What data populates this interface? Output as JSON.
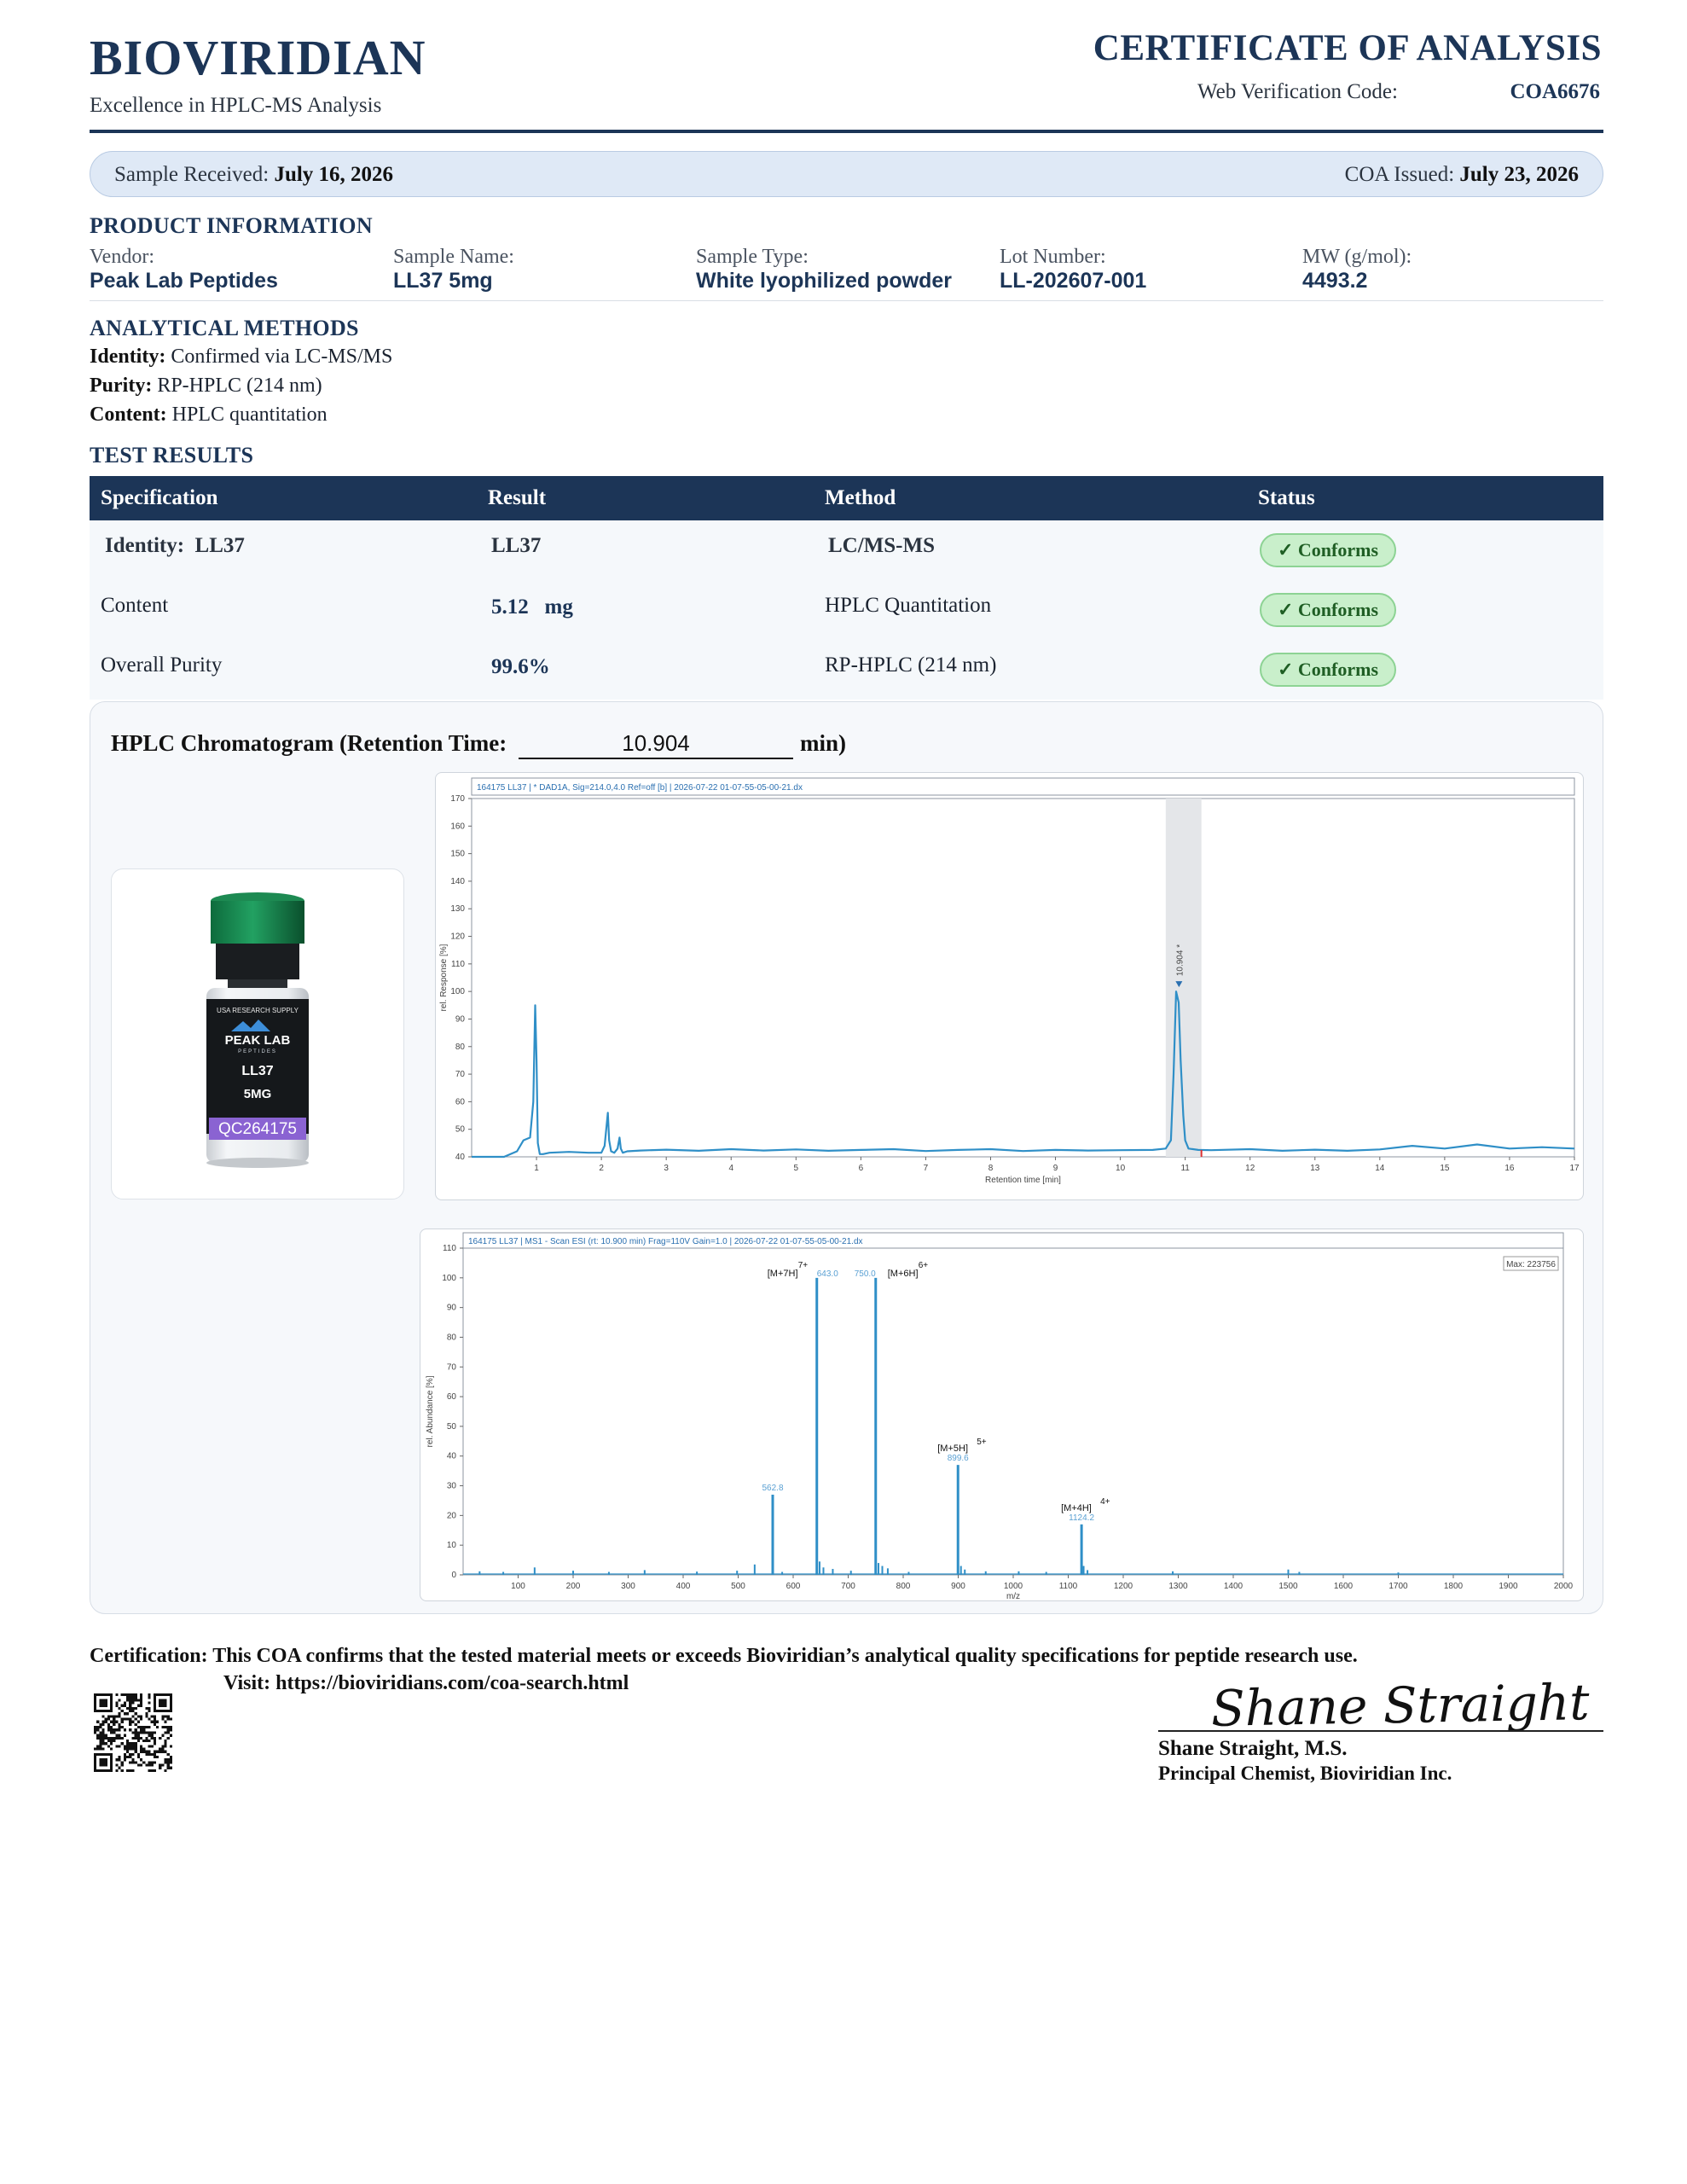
{
  "header": {
    "brand": "BIOVIRIDIAN",
    "tagline": "Excellence in HPLC-MS Analysis",
    "document_title": "CERTIFICATE OF ANALYSIS",
    "verification_label": "Web Verification Code:",
    "verification_code": "COA6676"
  },
  "dates": {
    "received_label": "Sample Received:",
    "received_value": "July 16, 2026",
    "issued_label": "COA Issued:",
    "issued_value": "July 23, 2026"
  },
  "product": {
    "heading": "PRODUCT INFORMATION",
    "fields": [
      {
        "label": "Vendor:",
        "value": "Peak Lab Peptides"
      },
      {
        "label": "Sample Name:",
        "value": "LL37 5mg"
      },
      {
        "label": "Sample Type:",
        "value": "White lyophilized powder"
      },
      {
        "label": "Lot Number:",
        "value": "LL-202607-001"
      },
      {
        "label": "MW (g/mol):",
        "value": "4493.2"
      }
    ]
  },
  "methods": {
    "heading": "ANALYTICAL METHODS",
    "lines": [
      {
        "label": "Identity:",
        "value": "Confirmed via LC-MS/MS"
      },
      {
        "label": "Purity:",
        "value": "RP-HPLC (214 nm)"
      },
      {
        "label": "Content:",
        "value": "HPLC quantitation"
      }
    ]
  },
  "results": {
    "heading": "TEST RESULTS",
    "columns": [
      "Specification",
      "Result",
      "Method",
      "Status"
    ],
    "rows": [
      {
        "spec": "Identity:  LL37",
        "result": "LL37",
        "method": "LC/MS-MS",
        "status": "✓ Conforms"
      },
      {
        "spec": "Content",
        "result": "5.12   mg",
        "method": "HPLC Quantitation",
        "status": "✓ Conforms"
      },
      {
        "spec": "Overall Purity",
        "result": "99.6%",
        "method": "RP-HPLC (214 nm)",
        "status": "✓ Conforms"
      }
    ]
  },
  "chromatogram": {
    "title": "HPLC Chromatogram (Retention Time:",
    "retention_time": "10.904",
    "unit": "min)",
    "vial": {
      "supplier": "USA RESEARCH SUPPLY",
      "brand": "PEAK LAB",
      "brand_sub": "PEPTIDES",
      "product": "LL37",
      "dose": "5MG",
      "qc_code": "QC264175"
    }
  },
  "chart_data": [
    {
      "type": "line",
      "header": "164175 LL37 | * DAD1A, Sig=214.0,4.0 Ref=off [b] | 2026-07-22 01-07-55-05-00-21.dx",
      "xlabel": "Retention time [min]",
      "ylabel": "rel. Response [%]",
      "xlim": [
        0,
        17
      ],
      "ylim": [
        40,
        170
      ],
      "x_ticks": [
        1,
        2,
        3,
        4,
        5,
        6,
        7,
        8,
        9,
        10,
        11,
        12,
        13,
        14,
        15,
        16,
        17
      ],
      "y_ticks": [
        40,
        50,
        60,
        70,
        80,
        90,
        100,
        110,
        120,
        130,
        140,
        150,
        160,
        170
      ],
      "peak_label": "10.904 *",
      "series": [
        {
          "x": [
            0.0,
            0.5,
            0.7,
            0.8,
            0.9,
            0.95,
            0.98,
            1.0,
            1.02,
            1.05,
            1.1,
            1.2,
            1.5,
            1.8,
            2.0,
            2.05,
            2.1,
            2.12,
            2.15,
            2.2,
            2.25,
            2.28,
            2.3,
            2.33,
            2.4,
            2.6,
            3.0,
            3.5,
            4.0,
            4.5,
            5.0,
            5.5,
            6.0,
            6.5,
            7.0,
            7.5,
            8.0,
            8.5,
            9.0,
            9.5,
            10.0,
            10.5,
            10.7,
            10.78,
            10.82,
            10.86,
            10.9,
            10.93,
            10.97,
            11.0,
            11.05,
            11.2,
            11.4,
            12.0,
            12.5,
            13.0,
            13.5,
            14.0,
            14.5,
            15.0,
            15.5,
            16.0,
            16.5,
            17.0
          ],
          "y": [
            40,
            40,
            42,
            46,
            47,
            60,
            95,
            75,
            45,
            41,
            41,
            41.5,
            41.8,
            41.5,
            41.5,
            44,
            56,
            46,
            42,
            41.5,
            43,
            47,
            43,
            41.5,
            42,
            42.3,
            42.6,
            42.2,
            42.8,
            42.3,
            42.7,
            42.2,
            42.5,
            42.8,
            42.1,
            42.5,
            42.8,
            42.1,
            42.5,
            42.3,
            42.4,
            42.5,
            43,
            46,
            70,
            100,
            96,
            75,
            55,
            46,
            43,
            42.5,
            42.4,
            42.8,
            42.2,
            42.6,
            42.2,
            42.7,
            44,
            43,
            44.5,
            43,
            43.5,
            43
          ]
        }
      ]
    },
    {
      "type": "bar",
      "header": "164175 LL37 | MS1 - Scan ESI (rt: 10.900 min) Frag=110V Gain=1.0 | 2026-07-22 01-07-55-05-00-21.dx",
      "xlabel": "m/z",
      "ylabel": "rel. Abundance [%]",
      "xlim": [
        0,
        2000
      ],
      "ylim": [
        0,
        110
      ],
      "x_ticks": [
        100,
        200,
        300,
        400,
        500,
        600,
        700,
        800,
        900,
        1000,
        1100,
        1200,
        1300,
        1400,
        1500,
        1600,
        1700,
        1800,
        1900,
        2000
      ],
      "y_ticks": [
        0,
        10,
        20,
        30,
        40,
        50,
        60,
        70,
        80,
        90,
        100,
        110
      ],
      "max_label": "Max: 223756",
      "peaks": [
        {
          "mz": 562.8,
          "intensity": 27,
          "label": "562.8"
        },
        {
          "mz": 643.0,
          "intensity": 100,
          "label": "643.0",
          "ion": "[M+7H]",
          "charge": "7+"
        },
        {
          "mz": 750.0,
          "intensity": 100,
          "label": "750.0",
          "ion": "[M+6H]",
          "charge": "6+"
        },
        {
          "mz": 899.6,
          "intensity": 37,
          "label": "899.6",
          "ion": "[M+5H]",
          "charge": "5+"
        },
        {
          "mz": 1124.2,
          "intensity": 17,
          "label": "1124.2",
          "ion": "[M+4H]",
          "charge": "4+"
        }
      ],
      "minor_peaks": [
        {
          "mz": 30,
          "intensity": 1.2
        },
        {
          "mz": 73,
          "intensity": 1.0
        },
        {
          "mz": 130,
          "intensity": 2.5
        },
        {
          "mz": 200,
          "intensity": 1.4
        },
        {
          "mz": 265,
          "intensity": 1.0
        },
        {
          "mz": 330,
          "intensity": 1.6
        },
        {
          "mz": 425,
          "intensity": 1.1
        },
        {
          "mz": 498,
          "intensity": 1.4
        },
        {
          "mz": 530,
          "intensity": 3.5
        },
        {
          "mz": 580,
          "intensity": 1.0
        },
        {
          "mz": 648,
          "intensity": 4.5
        },
        {
          "mz": 655,
          "intensity": 2.5
        },
        {
          "mz": 672,
          "intensity": 2.0
        },
        {
          "mz": 705,
          "intensity": 1.4
        },
        {
          "mz": 755,
          "intensity": 4.0
        },
        {
          "mz": 762,
          "intensity": 3.0
        },
        {
          "mz": 772,
          "intensity": 2.2
        },
        {
          "mz": 810,
          "intensity": 1.0
        },
        {
          "mz": 905,
          "intensity": 3.0
        },
        {
          "mz": 912,
          "intensity": 1.8
        },
        {
          "mz": 950,
          "intensity": 1.2
        },
        {
          "mz": 1010,
          "intensity": 1.2
        },
        {
          "mz": 1060,
          "intensity": 1.0
        },
        {
          "mz": 1128,
          "intensity": 3.0
        },
        {
          "mz": 1135,
          "intensity": 1.6
        },
        {
          "mz": 1290,
          "intensity": 1.2
        },
        {
          "mz": 1500,
          "intensity": 1.8
        },
        {
          "mz": 1520,
          "intensity": 1.0
        },
        {
          "mz": 1700,
          "intensity": 0.8
        }
      ]
    }
  ],
  "footer": {
    "certification_label": "Certification:",
    "certification_text": "This COA confirms that the tested material meets or exceeds Bioviridian’s analytical quality specifications for peptide research use.",
    "visit_text": "Visit: https://bioviridians.com/coa-search.html",
    "signature": "Shane Straight",
    "signer_name": "Shane Straight, M.S.",
    "signer_title": "Principal Chemist, Bioviridian Inc."
  },
  "colors": {
    "navy": "#1c3557",
    "trace": "#2f8fc7",
    "badge_bg": "#c9efcb",
    "badge_text": "#1f5e24"
  }
}
